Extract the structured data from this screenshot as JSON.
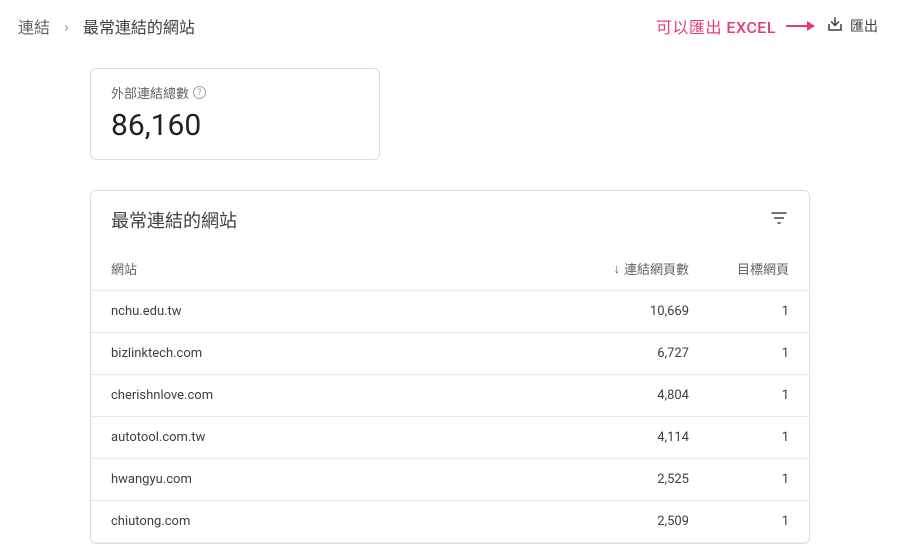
{
  "breadcrumb": {
    "root": "連結",
    "current": "最常連結的網站"
  },
  "export": {
    "note": "可以匯出 EXCEL",
    "label": "匯出"
  },
  "total_card": {
    "label": "外部連結總數",
    "value": "86,160"
  },
  "table": {
    "title": "最常連結的網站",
    "columns": {
      "site": "網站",
      "pages": "連結網頁數",
      "target": "目標網頁"
    },
    "rows": [
      {
        "site": "nchu.edu.tw",
        "pages": "10,669",
        "target": "1"
      },
      {
        "site": "bizlinktech.com",
        "pages": "6,727",
        "target": "1"
      },
      {
        "site": "cherishnlove.com",
        "pages": "4,804",
        "target": "1"
      },
      {
        "site": "autotool.com.tw",
        "pages": "4,114",
        "target": "1"
      },
      {
        "site": "hwangyu.com",
        "pages": "2,525",
        "target": "1"
      },
      {
        "site": "chiutong.com",
        "pages": "2,509",
        "target": "1"
      }
    ]
  }
}
